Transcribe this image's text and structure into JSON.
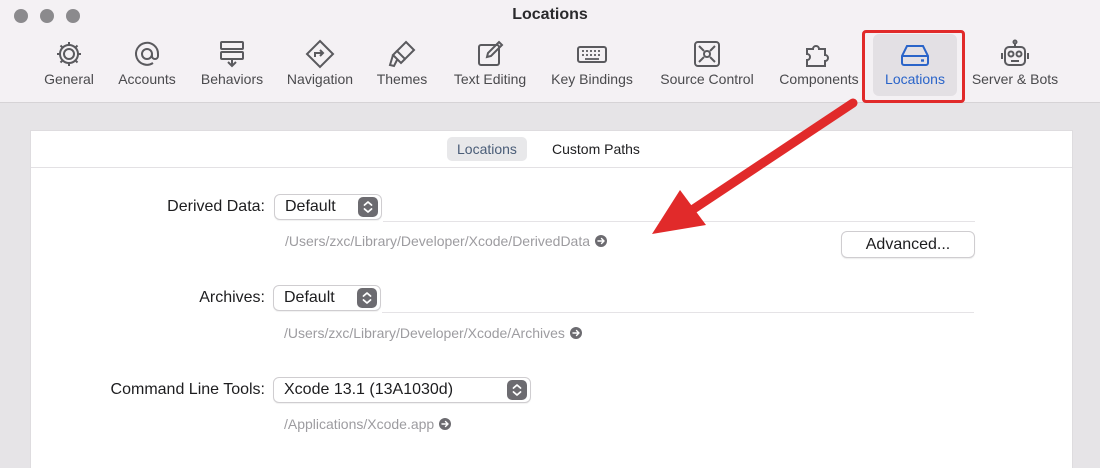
{
  "window": {
    "title": "Locations"
  },
  "toolbar": {
    "tabs": [
      {
        "label": "General",
        "icon": "gear-icon"
      },
      {
        "label": "Accounts",
        "icon": "at-sign-icon"
      },
      {
        "label": "Behaviors",
        "icon": "behaviors-icon"
      },
      {
        "label": "Navigation",
        "icon": "navigation-icon"
      },
      {
        "label": "Themes",
        "icon": "brush-icon"
      },
      {
        "label": "Text Editing",
        "icon": "pencil-square-icon"
      },
      {
        "label": "Key Bindings",
        "icon": "keyboard-icon"
      },
      {
        "label": "Source Control",
        "icon": "source-control-icon"
      },
      {
        "label": "Components",
        "icon": "puzzle-icon"
      },
      {
        "label": "Locations",
        "icon": "drive-icon",
        "active": true
      },
      {
        "label": "Server & Bots",
        "icon": "robot-icon"
      }
    ]
  },
  "segments": {
    "locations": "Locations",
    "custom_paths": "Custom Paths",
    "selected": "Locations"
  },
  "derived_data": {
    "label": "Derived Data:",
    "value": "Default",
    "path": "/Users/zxc/Library/Developer/Xcode/DerivedData",
    "advanced_label": "Advanced..."
  },
  "archives": {
    "label": "Archives:",
    "value": "Default",
    "path": "/Users/zxc/Library/Developer/Xcode/Archives"
  },
  "command_line_tools": {
    "label": "Command Line Tools:",
    "value": "Xcode 13.1 (13A1030d)",
    "path": "/Applications/Xcode.app"
  },
  "colors": {
    "accent": "#2a64c9",
    "annotation_red": "#e12a2a"
  }
}
